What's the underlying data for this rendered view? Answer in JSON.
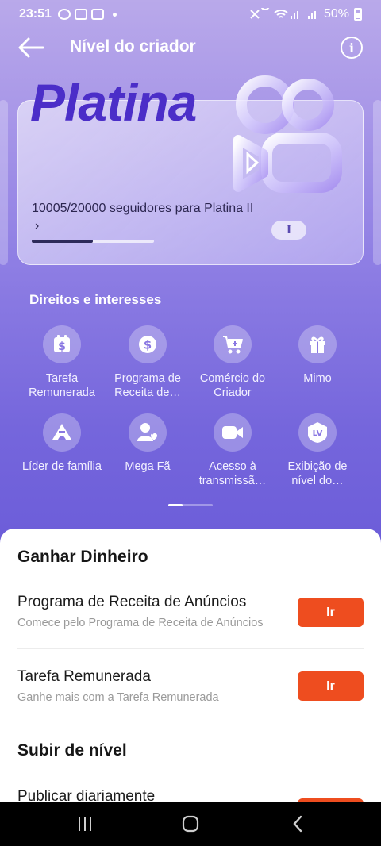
{
  "status_bar": {
    "time": "23:51",
    "battery": "50%"
  },
  "header": {
    "title": "Nível do criador",
    "info_symbol": "i"
  },
  "level_card": {
    "level_name": "Platina",
    "progress_text": "10005/20000 seguidores para Platina II",
    "progress_chevron": "›",
    "progress_fraction": 0.5,
    "tier_roman": "I"
  },
  "benefits": {
    "title": "Direitos e interesses",
    "items": [
      {
        "label": "Tarefa Remunerada",
        "icon": "dollar-calendar-icon"
      },
      {
        "label": "Programa de Receita de…",
        "icon": "dollar-coin-icon"
      },
      {
        "label": "Comércio do Criador",
        "icon": "shopping-cart-icon"
      },
      {
        "label": "Mimo",
        "icon": "gift-icon"
      },
      {
        "label": "Líder de família",
        "icon": "tent-icon"
      },
      {
        "label": "Mega Fã",
        "icon": "user-heart-icon"
      },
      {
        "label": "Acesso à transmissã…",
        "icon": "video-camera-icon"
      },
      {
        "label": "Exibição de nível do…",
        "icon": "lv-badge-icon"
      }
    ]
  },
  "sheet": {
    "earn_title": "Ganhar Dinheiro",
    "tasks": [
      {
        "title": "Programa de Receita de Anúncios",
        "subtitle": "Comece pelo Programa de Receita de Anúncios",
        "button": "Ir"
      },
      {
        "title": "Tarefa Remunerada",
        "subtitle": "Ganhe mais com a Tarefa Remunerada",
        "button": "Ir"
      }
    ],
    "levelup_title": "Subir de nível",
    "levelup_tasks": [
      {
        "title": "Publicar diariamente"
      }
    ]
  },
  "colors": {
    "accent": "#ee4d1f",
    "level_text": "#4b2ec8",
    "bg_top": "#b9a9ea",
    "bg_bottom": "#6a5bd8"
  }
}
